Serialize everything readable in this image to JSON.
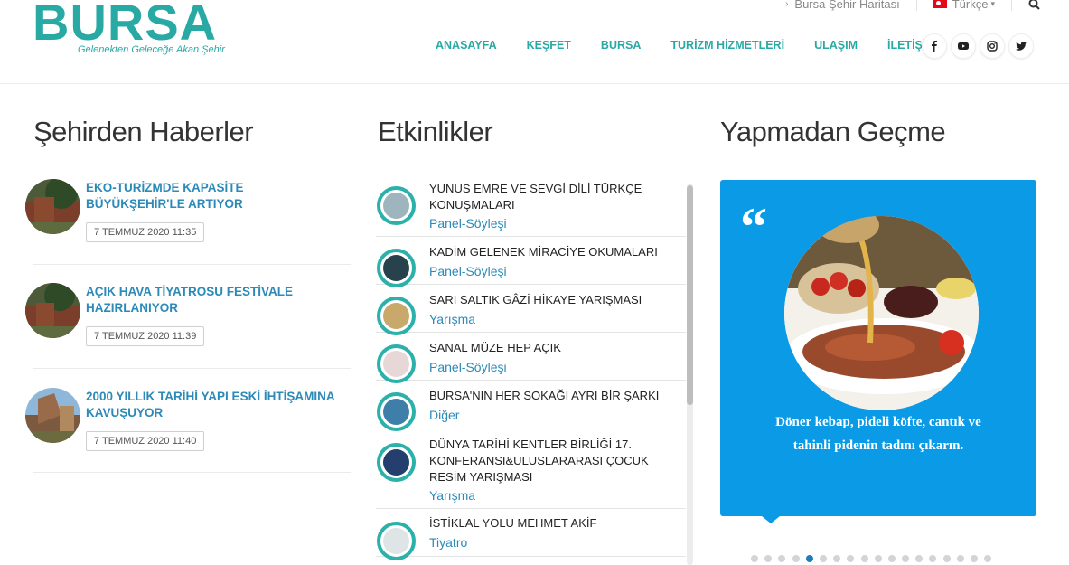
{
  "header": {
    "logo_text": "BURSA",
    "logo_tagline": "Gelenekten Geleceğe Akan Şehir",
    "topbar": {
      "city_map": "Bursa Şehir Haritası",
      "language": "Türkçe"
    },
    "nav": [
      "ANASAYFA",
      "KEŞFET",
      "BURSA",
      "TURİZM HİZMETLERİ",
      "ULAŞIM",
      "İLETİŞİM"
    ],
    "social": [
      "facebook-icon",
      "youtube-icon",
      "instagram-icon",
      "twitter-icon"
    ]
  },
  "news": {
    "title": "Şehirden Haberler",
    "items": [
      {
        "title": "EKO-TURİZMDE KAPASİTE BÜYÜKŞEHİR'LE ARTIYOR",
        "date": "7 TEMMUZ 2020 11:35"
      },
      {
        "title": "AÇIK HAVA TİYATROSU FESTİVALE HAZIRLANIYOR",
        "date": "7 TEMMUZ 2020 11:39"
      },
      {
        "title": "2000 YILLIK TARİHİ YAPI ESKİ İHTİŞAMINA KAVUŞUYOR",
        "date": "7 TEMMUZ 2020 11:40"
      }
    ]
  },
  "events": {
    "title": "Etkinlikler",
    "items": [
      {
        "title": "YUNUS EMRE VE SEVGİ DİLİ TÜRKÇE KONUŞMALARI",
        "category": "Panel-Söyleşi"
      },
      {
        "title": "KADİM GELENEK MİRACİYE OKUMALARI",
        "category": "Panel-Söyleşi"
      },
      {
        "title": "SARI SALTIK GÂZİ HİKAYE YARIŞMASI",
        "category": "Yarışma"
      },
      {
        "title": "SANAL MÜZE HEP AÇIK",
        "category": "Panel-Söyleşi"
      },
      {
        "title": "BURSA'NIN HER SOKAĞI AYRI BİR ŞARKI",
        "category": "Diğer"
      },
      {
        "title": "DÜNYA TARİHİ KENTLER BİRLİĞİ 17. KONFERANSI&ULUSLARARASI ÇOCUK RESİM YARIŞMASI",
        "category": "Yarışma"
      },
      {
        "title": "İSTİKLAL YOLU MEHMET AKİF",
        "category": "Tiyatro"
      }
    ]
  },
  "recommend": {
    "title": "Yapmadan Geçme",
    "quote_mark": "“",
    "text": "Döner kebap, pideli köfte, cantık ve tahinli pidenin tadını çıkarın.",
    "slide_count": 18,
    "active_slide": 5
  },
  "colors": {
    "teal": "#29a9a4",
    "link_blue": "#2b8ab8",
    "card_blue": "#0a9ae6"
  }
}
